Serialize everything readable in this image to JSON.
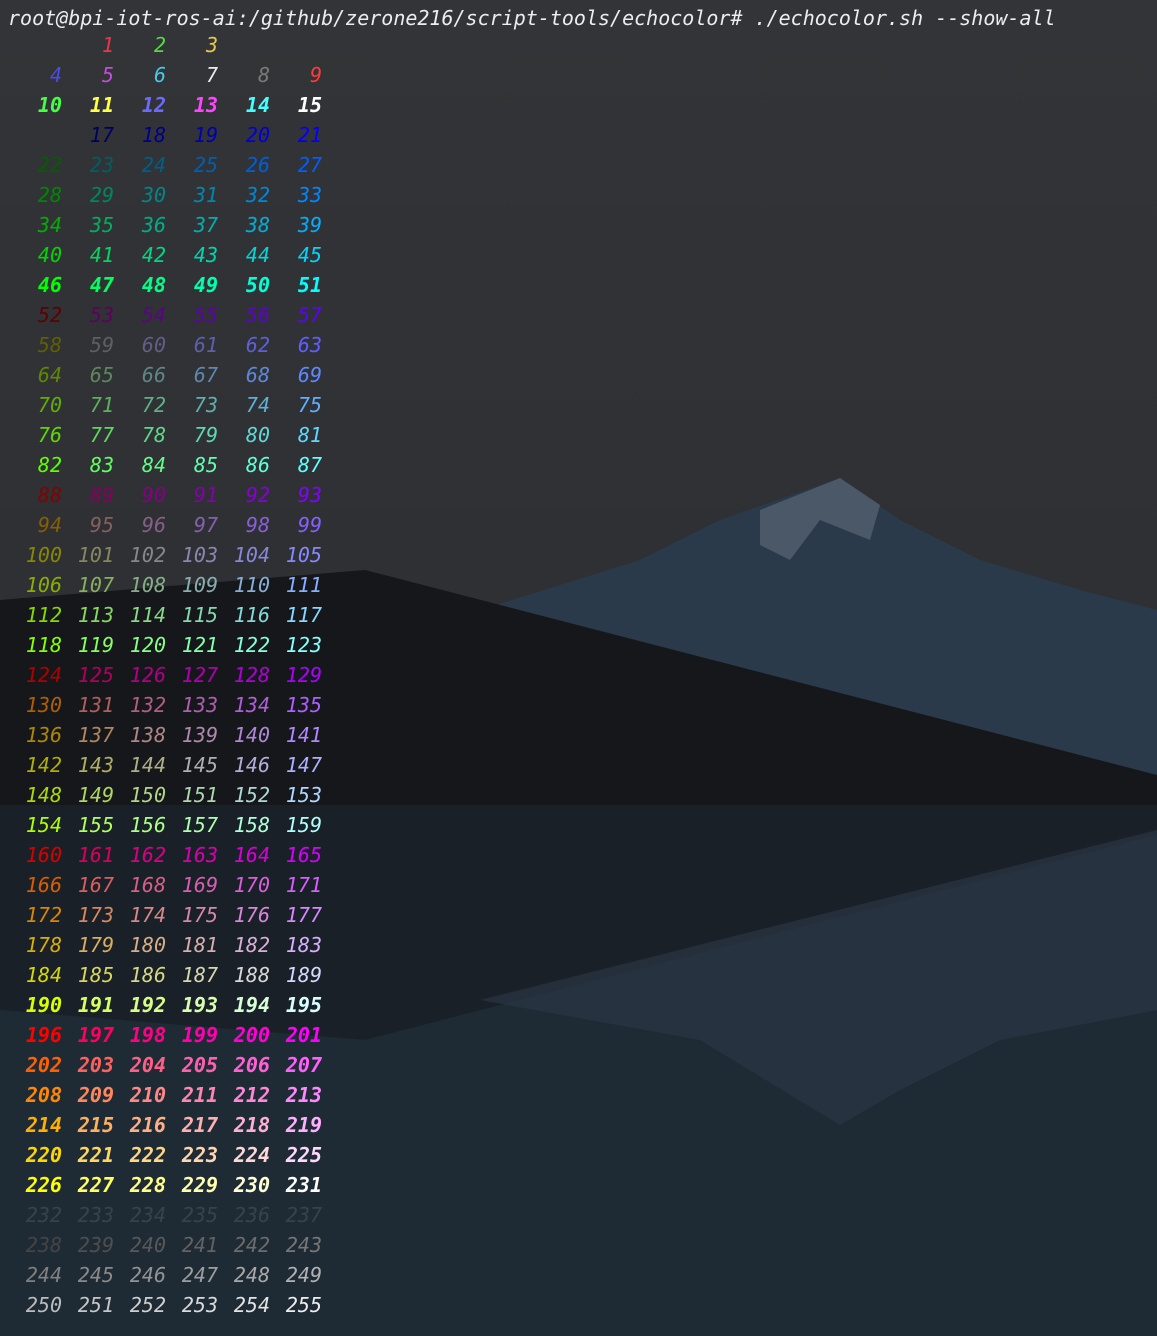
{
  "terminal": {
    "prompt": "root@bpi-iot-ros-ai:/github/zerone216/script-tools/echocolor# ./echocolor.sh --show-all"
  },
  "color_rows": [
    [
      null,
      "1",
      "2",
      "3",
      null,
      null
    ],
    [
      "4",
      "5",
      "6",
      "7",
      "8",
      "9"
    ],
    [
      "10",
      "11",
      "12",
      "13",
      "14",
      "15"
    ],
    [
      null,
      "17",
      "18",
      "19",
      "20",
      "21"
    ],
    [
      "22",
      "23",
      "24",
      "25",
      "26",
      "27"
    ],
    [
      "28",
      "29",
      "30",
      "31",
      "32",
      "33"
    ],
    [
      "34",
      "35",
      "36",
      "37",
      "38",
      "39"
    ],
    [
      "40",
      "41",
      "42",
      "43",
      "44",
      "45"
    ],
    [
      "46",
      "47",
      "48",
      "49",
      "50",
      "51"
    ],
    [
      "52",
      "53",
      "54",
      "55",
      "56",
      "57"
    ],
    [
      "58",
      "59",
      "60",
      "61",
      "62",
      "63"
    ],
    [
      "64",
      "65",
      "66",
      "67",
      "68",
      "69"
    ],
    [
      "70",
      "71",
      "72",
      "73",
      "74",
      "75"
    ],
    [
      "76",
      "77",
      "78",
      "79",
      "80",
      "81"
    ],
    [
      "82",
      "83",
      "84",
      "85",
      "86",
      "87"
    ],
    [
      "88",
      "89",
      "90",
      "91",
      "92",
      "93"
    ],
    [
      "94",
      "95",
      "96",
      "97",
      "98",
      "99"
    ],
    [
      "100",
      "101",
      "102",
      "103",
      "104",
      "105"
    ],
    [
      "106",
      "107",
      "108",
      "109",
      "110",
      "111"
    ],
    [
      "112",
      "113",
      "114",
      "115",
      "116",
      "117"
    ],
    [
      "118",
      "119",
      "120",
      "121",
      "122",
      "123"
    ],
    [
      "124",
      "125",
      "126",
      "127",
      "128",
      "129"
    ],
    [
      "130",
      "131",
      "132",
      "133",
      "134",
      "135"
    ],
    [
      "136",
      "137",
      "138",
      "139",
      "140",
      "141"
    ],
    [
      "142",
      "143",
      "144",
      "145",
      "146",
      "147"
    ],
    [
      "148",
      "149",
      "150",
      "151",
      "152",
      "153"
    ],
    [
      "154",
      "155",
      "156",
      "157",
      "158",
      "159"
    ],
    [
      "160",
      "161",
      "162",
      "163",
      "164",
      "165"
    ],
    [
      "166",
      "167",
      "168",
      "169",
      "170",
      "171"
    ],
    [
      "172",
      "173",
      "174",
      "175",
      "176",
      "177"
    ],
    [
      "178",
      "179",
      "180",
      "181",
      "182",
      "183"
    ],
    [
      "184",
      "185",
      "186",
      "187",
      "188",
      "189"
    ],
    [
      "190",
      "191",
      "192",
      "193",
      "194",
      "195"
    ],
    [
      "196",
      "197",
      "198",
      "199",
      "200",
      "201"
    ],
    [
      "202",
      "203",
      "204",
      "205",
      "206",
      "207"
    ],
    [
      "208",
      "209",
      "210",
      "211",
      "212",
      "213"
    ],
    [
      "214",
      "215",
      "216",
      "217",
      "218",
      "219"
    ],
    [
      "220",
      "221",
      "222",
      "223",
      "224",
      "225"
    ],
    [
      "226",
      "227",
      "228",
      "229",
      "230",
      "231"
    ],
    [
      "232",
      "233",
      "234",
      "235",
      "236",
      "237"
    ],
    [
      "238",
      "239",
      "240",
      "241",
      "242",
      "243"
    ],
    [
      "244",
      "245",
      "246",
      "247",
      "248",
      "249"
    ],
    [
      "250",
      "251",
      "252",
      "253",
      "254",
      "255"
    ]
  ],
  "colors": {
    "prompt_text": "#ecedee",
    "background_top": "#333437",
    "background_bottom": "#1b2a33"
  }
}
